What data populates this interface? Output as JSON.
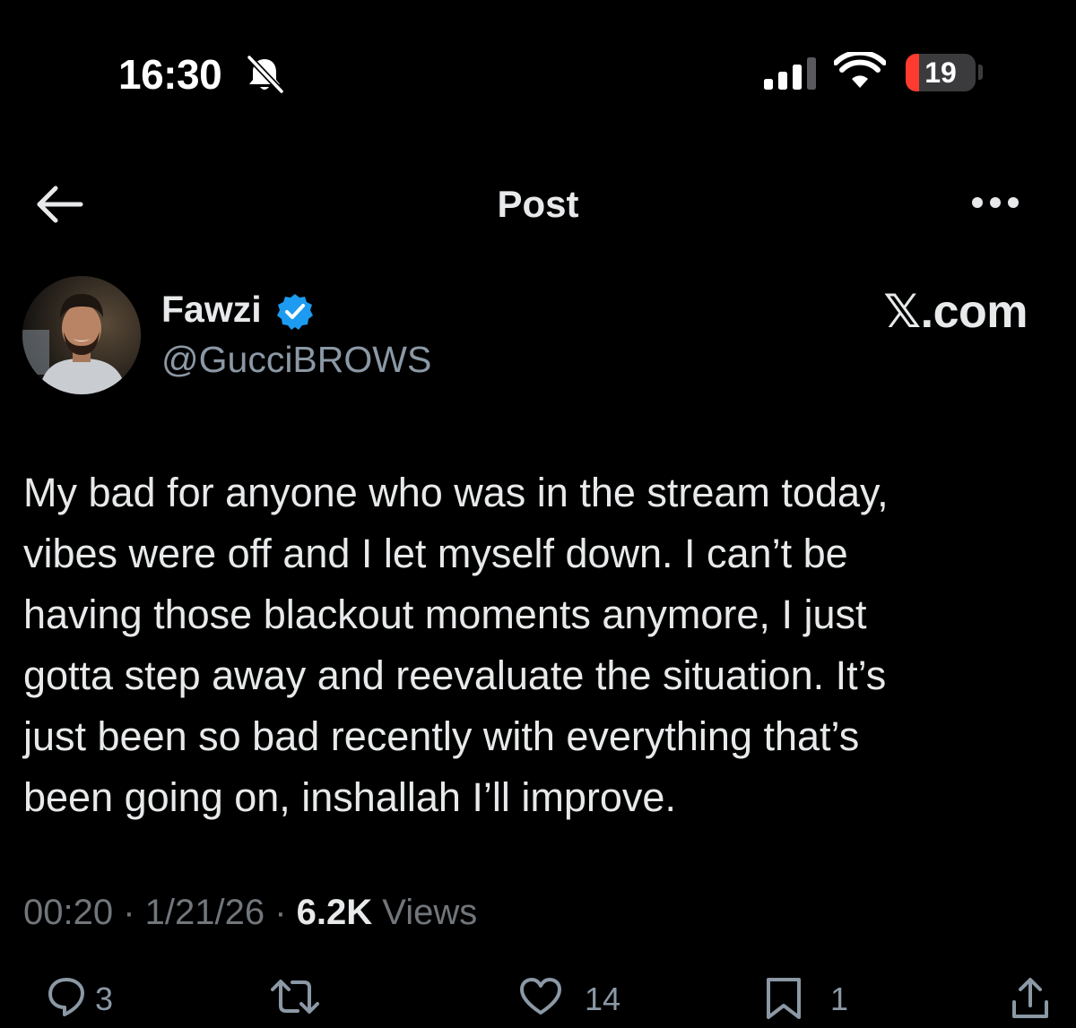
{
  "status_bar": {
    "time": "16:30",
    "battery_level": "19",
    "battery_fraction": 0.19,
    "icons": [
      "bell-slash-icon",
      "cellular-signal-icon",
      "wifi-icon",
      "battery-icon"
    ]
  },
  "nav": {
    "title": "Post",
    "back_icon": "arrow-left-icon",
    "more_icon": "ellipsis-icon"
  },
  "author": {
    "name": "Fawzi",
    "handle": "@GucciBROWS",
    "verified_icon": "verified-badge-icon"
  },
  "brand": "𝕏.com",
  "tweet": {
    "lines": [
      "My bad for anyone who was in the stream today,",
      "vibes were off and I let myself down. I can’t be",
      "having those blackout moments anymore, I just",
      "gotta step away and reevaluate the situation. It’s",
      "just been so bad recently with everything that’s",
      "been going on, inshallah I’ll improve."
    ]
  },
  "meta": {
    "time": "00:20",
    "date": "1/21/26",
    "views_count": "6.2K",
    "views_label": "Views"
  },
  "actions": {
    "replies": "3",
    "reposts": "",
    "likes": "14",
    "bookmarks": "1",
    "icons": [
      "reply-icon",
      "repost-icon",
      "like-icon",
      "bookmark-icon",
      "share-icon"
    ]
  },
  "colors": {
    "background": "#000000",
    "primary_text": "#e7e9ea",
    "secondary_text": "#71767b",
    "verified_blue": "#1d9bf0",
    "battery_red": "#ff3b30"
  }
}
